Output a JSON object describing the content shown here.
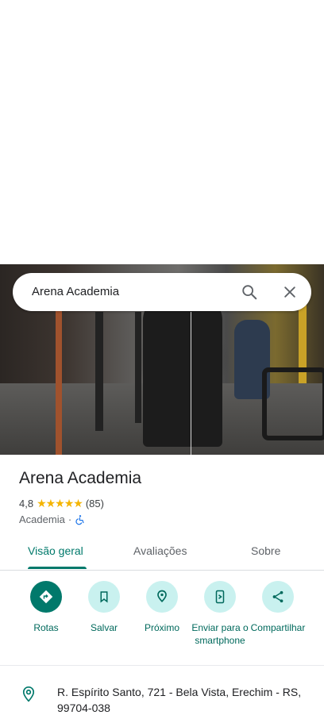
{
  "search": {
    "query": "Arena Academia"
  },
  "place": {
    "name": "Arena Academia",
    "rating": "4,8",
    "stars": "★★★★★",
    "review_count": "(85)",
    "category": "Academia",
    "separator": "·",
    "address": "R. Espírito Santo, 721 - Bela Vista, Erechim - RS, 99704-038"
  },
  "tabs": [
    {
      "label": "Visão geral",
      "active": true
    },
    {
      "label": "Avaliações",
      "active": false
    },
    {
      "label": "Sobre",
      "active": false
    }
  ],
  "actions": [
    {
      "label": "Rotas",
      "icon": "directions-icon"
    },
    {
      "label": "Salvar",
      "icon": "bookmark-icon"
    },
    {
      "label": "Próximo",
      "icon": "nearby-icon"
    },
    {
      "label": "Enviar para o smartphone",
      "icon": "send-to-phone-icon"
    },
    {
      "label": "Compartilhar",
      "icon": "share-icon"
    }
  ],
  "colors": {
    "accent": "#00796b",
    "action_bg": "#c9f1ef",
    "star": "#f4b400"
  }
}
